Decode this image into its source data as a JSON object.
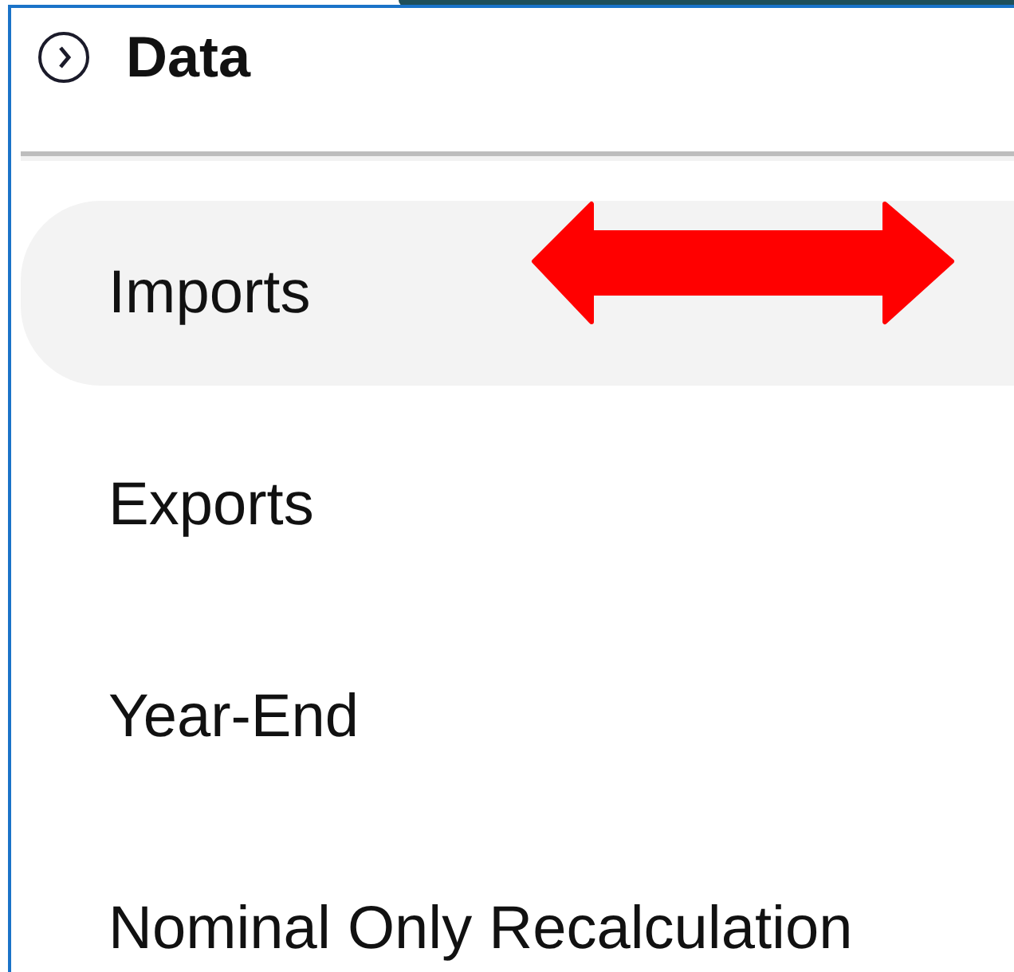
{
  "section": {
    "title": "Data",
    "expanded": true
  },
  "items": [
    {
      "label": "Imports",
      "selected": true
    },
    {
      "label": "Exports",
      "selected": false
    },
    {
      "label": "Year-End",
      "selected": false
    },
    {
      "label": "Nominal Only Recalculation",
      "selected": false
    }
  ],
  "annotation": {
    "kind": "double-arrow"
  }
}
